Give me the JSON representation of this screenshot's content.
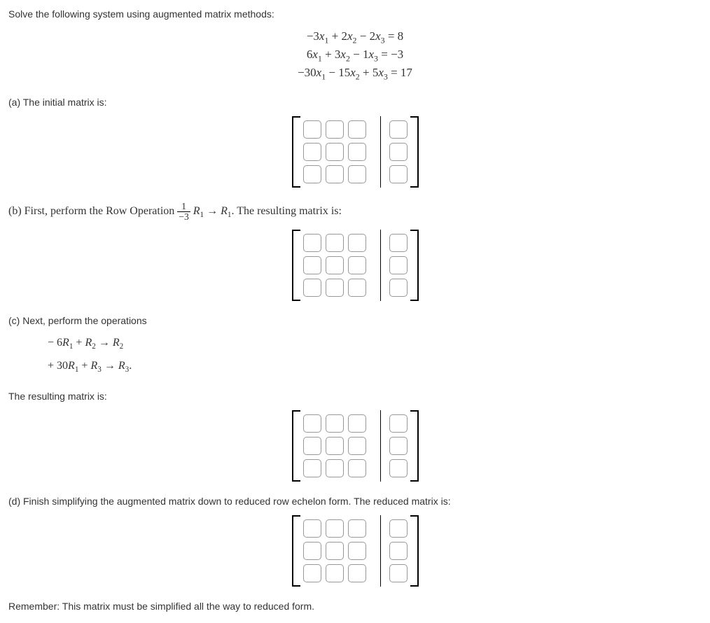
{
  "intro": "Solve the following system using augmented matrix methods:",
  "equations": {
    "line1": "−3x₁ + 2x₂ − 2x₃ = 8",
    "line2": "6x₁ + 3x₂ − 1x₃ = −3",
    "line3": "−30x₁ − 15x₂ + 5x₃ = 17"
  },
  "partA": {
    "label": "(a) The initial matrix is:"
  },
  "partB": {
    "prefix": "(b) First, perform the Row Operation ",
    "frac_num": "1",
    "frac_den": "−3",
    "mid": "R₁ → R₁. The resulting matrix is:"
  },
  "partC": {
    "label": "(c) Next, perform the operations",
    "op1": "− 6R₁ + R₂ → R₂",
    "op2": "+ 30R₁ + R₃ → R₃.",
    "result": "The resulting matrix is:"
  },
  "partD": {
    "label": "(d) Finish simplifying the augmented matrix down to reduced row echelon form. The reduced matrix is:"
  },
  "footer": "Remember: This matrix must be simplified all the way to reduced form."
}
